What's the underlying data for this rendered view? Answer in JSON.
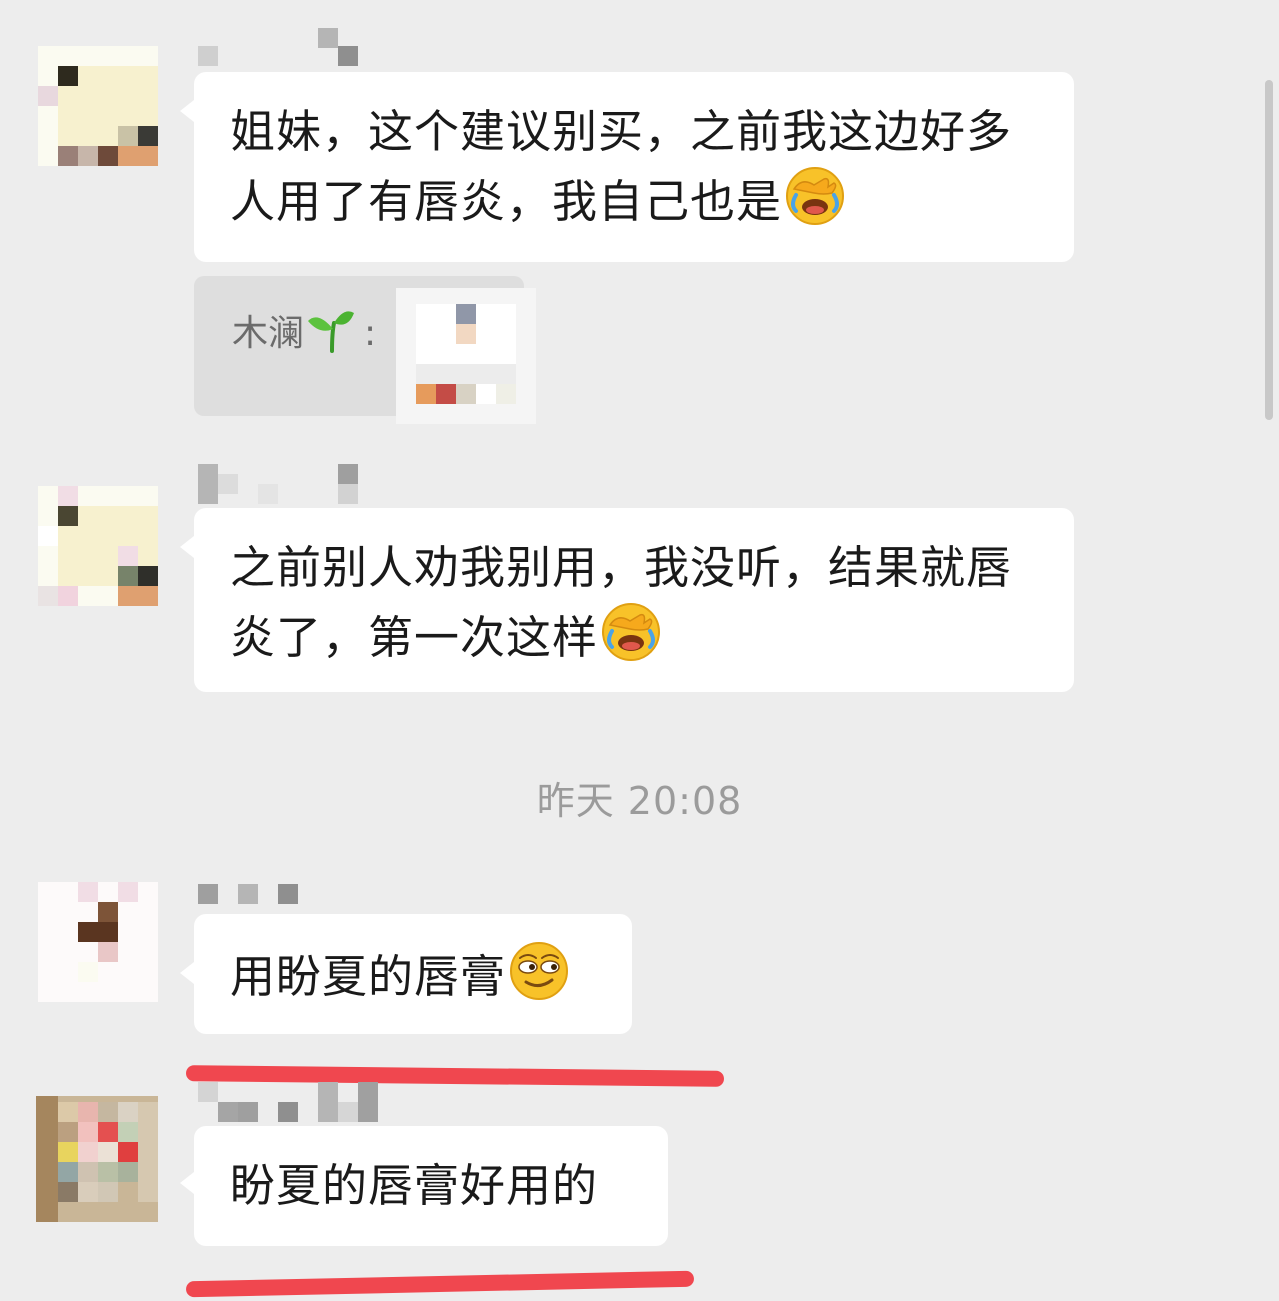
{
  "colors": {
    "background": "#ededed",
    "bubble": "#ffffff",
    "quote_background": "#dedede",
    "timestamp_text": "#9b9b9b",
    "annotation_underline": "#f0474f"
  },
  "messages": [
    {
      "text": "姐妹，这个建议别买，之前我这边好多人用了有唇炎，我自己也是",
      "emoji": "facepalm-laugh-emoji",
      "quote": {
        "sender": "木澜",
        "sender_emoji": "seedling-emoji",
        "colon": ":"
      }
    },
    {
      "text": "之前别人劝我别用，我没听，结果就唇炎了，第一次这样",
      "emoji": "facepalm-laugh-emoji"
    },
    {
      "text": "用盼夏的唇膏",
      "emoji": "smirk-emoji"
    },
    {
      "text": "盼夏的唇膏好用的"
    }
  ],
  "timestamp": "昨天 20:08",
  "icons": [
    "facepalm-laugh-emoji",
    "seedling-emoji",
    "smirk-emoji",
    "pixelated-avatar-icon"
  ]
}
